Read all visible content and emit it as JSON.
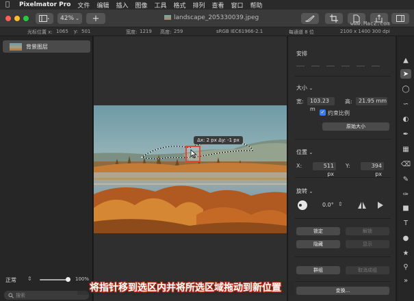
{
  "menubar": {
    "app_name": "Pixelmator Pro",
    "items": [
      "文件",
      "编辑",
      "插入",
      "图像",
      "工具",
      "格式",
      "排列",
      "查看",
      "窗口",
      "帮助"
    ]
  },
  "toolbar": {
    "zoom": "42%",
    "add_label": "+",
    "document_title": "landscape_205330039.jpeg",
    "watermark": "www.MacZ.com"
  },
  "infobar": {
    "cursor_label": "光标位置 x:",
    "cursor_x": "1065",
    "cursor_y_label": "y:",
    "cursor_y": "501",
    "width_label": "宽度:",
    "width": "1219",
    "height_label": "高度:",
    "height": "259",
    "color_profile": "sRGB IEC61966-2.1",
    "channel_depth": "每通道 8 位",
    "image_size": "2100 x 1400 300 dpi"
  },
  "layers": {
    "items": [
      {
        "name": "背景图层"
      }
    ],
    "blend_mode": "正常",
    "opacity": "100%",
    "search_placeholder": "搜索"
  },
  "canvas": {
    "tooltip": "Δx: 2 px Δy: -1 px"
  },
  "panel": {
    "arrange_title": "安排",
    "size_title": "大小",
    "width_label": "宽:",
    "width_value": "103.23 m",
    "height_label": "高:",
    "height_value": "21.95 mm",
    "constrain_label": "约束比例",
    "original_size_button": "原始大小",
    "position_title": "位置",
    "x_label": "X:",
    "x_value": "511 px",
    "y_label": "Y:",
    "y_value": "394 px",
    "rotate_title": "旋转",
    "rotate_value": "0.0°",
    "lock_button": "锁定",
    "unlock_button": "解锁",
    "hide_button": "隐藏",
    "show_button": "显示",
    "group_button": "群组",
    "ungroup_button": "取消成组",
    "transform_button": "变换..."
  },
  "caption": "将指针移到选区内并将所选区域拖动到新位置",
  "colors": {
    "close": "#ff5f57",
    "minimize": "#febc2e",
    "zoom": "#28c840",
    "selection_highlight": "#e8452e",
    "checkbox": "#3b7df0"
  }
}
